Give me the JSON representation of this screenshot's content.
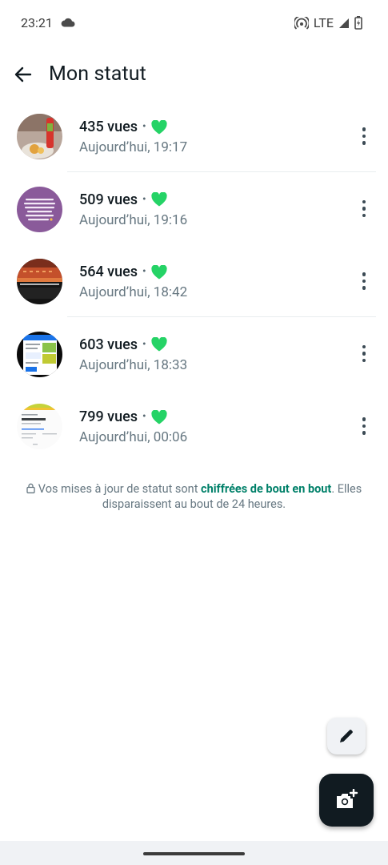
{
  "status_bar": {
    "time": "23:21",
    "network": "LTE",
    "icons": [
      "cloud-icon",
      "hotspot-icon",
      "signal-icon",
      "battery-charging-icon"
    ]
  },
  "header": {
    "title": "Mon statut",
    "back_icon": "arrow-left-icon"
  },
  "statuses": [
    {
      "views": "435 vues",
      "time": "Aujourd’hui, 19:17"
    },
    {
      "views": "509 vues",
      "time": "Aujourd’hui, 19:16"
    },
    {
      "views": "564 vues",
      "time": "Aujourd’hui, 18:42"
    },
    {
      "views": "603 vues",
      "time": "Aujourd’hui, 18:33"
    },
    {
      "views": "799 vues",
      "time": "Aujourd’hui, 00:06"
    }
  ],
  "separator": "•",
  "footer": {
    "text_before": "Vos mises à jour de statut sont ",
    "link_text": "chiffrées de bout en bout",
    "text_after": ". Elles disparaissent au bout de 24 heures."
  },
  "colors": {
    "accent_green": "#25d366",
    "link_green": "#008069",
    "primary_text": "#111b21",
    "secondary_text": "#667781",
    "fab_dark": "#111b21"
  },
  "fabs": {
    "pencil_icon": "pencil-icon",
    "camera_icon": "camera-add-icon"
  }
}
